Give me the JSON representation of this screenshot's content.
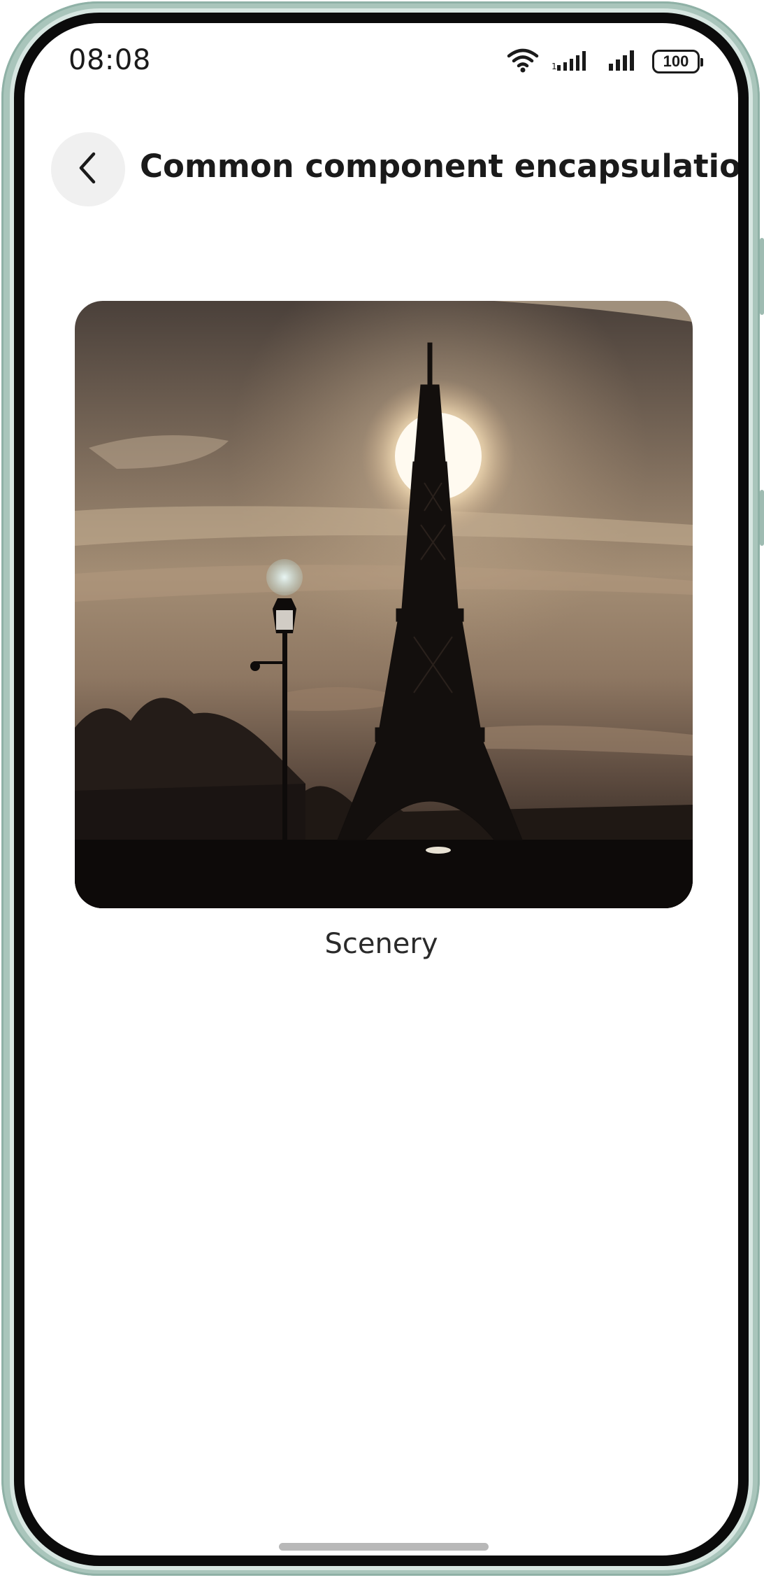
{
  "status_bar": {
    "time": "08:08",
    "battery_level": "100",
    "icons": [
      "wifi-icon",
      "signal-icon",
      "signal-icon",
      "battery-icon"
    ]
  },
  "header": {
    "back_icon": "chevron-left-icon",
    "title": "Common component encapsulation"
  },
  "content": {
    "image_subject": "Eiffel Tower silhouette at sunset with street lamp",
    "caption": "Scenery"
  },
  "colors": {
    "background": "#ffffff",
    "text": "#1a1a1a",
    "back_button_bg": "#f0f0f0",
    "frame": "#a9c5bb"
  }
}
